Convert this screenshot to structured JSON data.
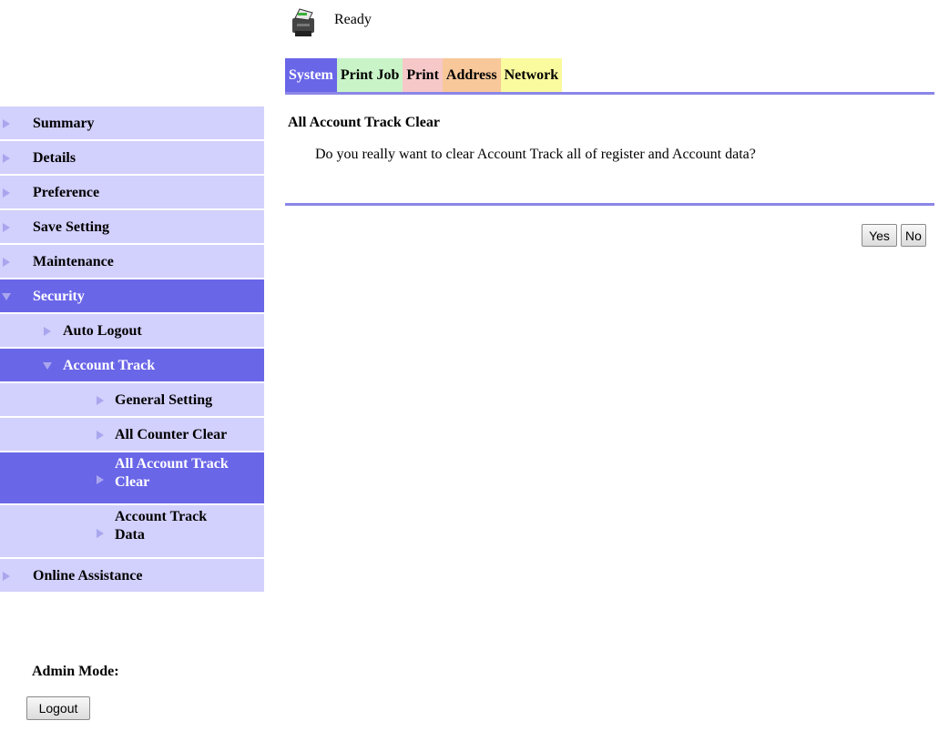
{
  "status": {
    "text": "Ready",
    "icon": "printer-icon"
  },
  "tabs": [
    {
      "label": "System",
      "color": "#6a66e8",
      "active": true
    },
    {
      "label": "Print Job",
      "color": "#c8f4c8"
    },
    {
      "label": "Print",
      "color": "#f6c8c8"
    },
    {
      "label": "Address",
      "color": "#f8c89a"
    },
    {
      "label": "Network",
      "color": "#fafa9e"
    }
  ],
  "sidebar": {
    "items": [
      {
        "label": "Summary"
      },
      {
        "label": "Details"
      },
      {
        "label": "Preference"
      },
      {
        "label": "Save Setting"
      },
      {
        "label": "Maintenance"
      },
      {
        "label": "Security",
        "selected": true,
        "expanded": true
      },
      {
        "label": "Auto Logout"
      },
      {
        "label": "Account Track",
        "selected": true,
        "expanded": true
      },
      {
        "label": "General Setting"
      },
      {
        "label": "All Counter Clear"
      },
      {
        "label_line1": "All Account Track",
        "label_line2": "Clear",
        "selected": true
      },
      {
        "label_line1": "Account Track",
        "label_line2": "Data"
      },
      {
        "label": "Online Assistance"
      }
    ]
  },
  "admin": {
    "label": "Admin Mode:",
    "logout_label": "Logout"
  },
  "content": {
    "title": "All Account Track Clear",
    "message": "Do you really want to clear Account Track all of register and Account data?",
    "yes_label": "Yes",
    "no_label": "No"
  },
  "colors": {
    "sidebar_bg": "#d2d0fc",
    "selected_bg": "#6a66e8",
    "rule": "#8b86e8"
  }
}
